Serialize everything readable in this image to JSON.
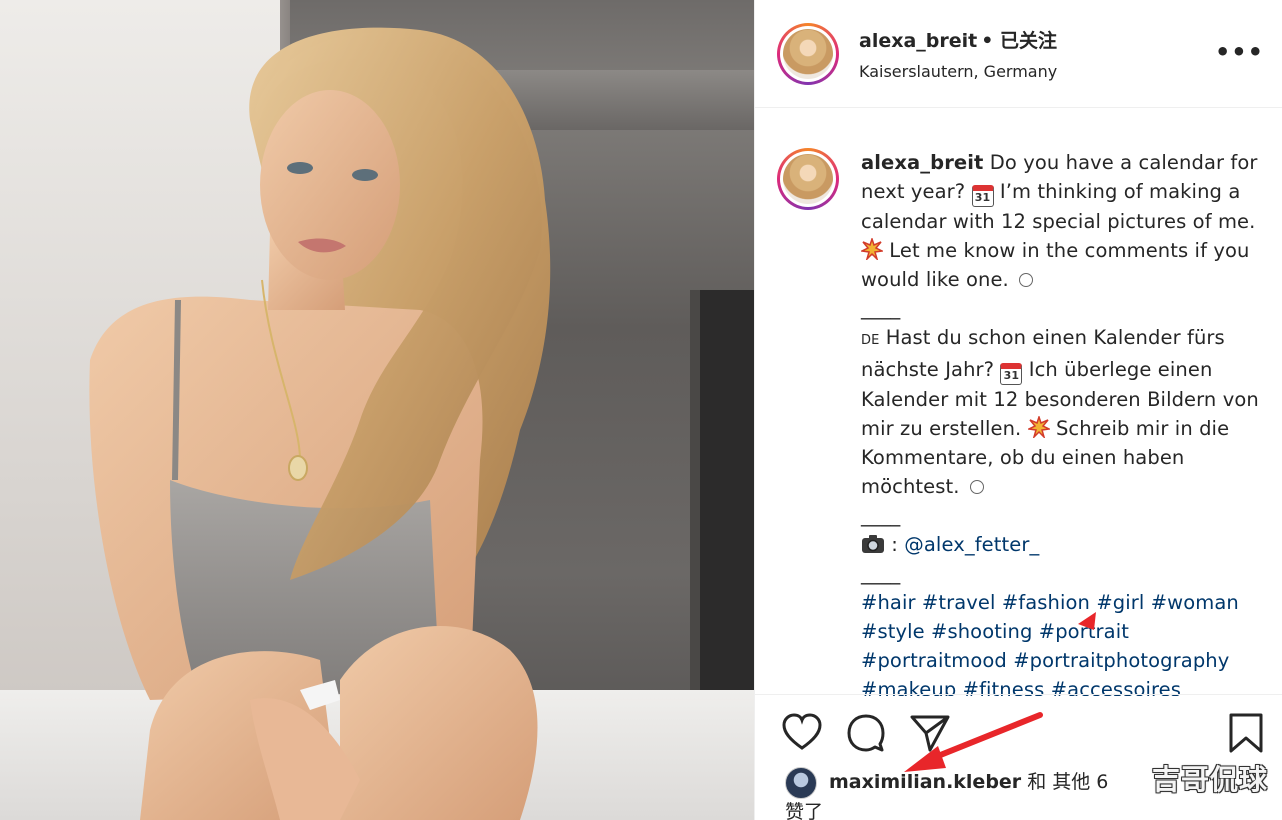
{
  "post": {
    "username": "alexa_breit",
    "follow_status": "• 已关注",
    "location": "Kaiserslautern, Germany",
    "more_label": "•••"
  },
  "caption": {
    "username": "alexa_breit",
    "en_1": " Do you have a calendar for next year? ",
    "calendar_emoji": "31",
    "en_2": " I’m thinking of making a calendar with 12 special pictures of me. ",
    "en_3": " Let me know in the comments if you would like one. ",
    "sep": "____",
    "de_flag": "DE",
    "de_1": " Hast du schon einen Kalender fürs nächste Jahr? ",
    "de_2": " Ich überlege einen Kalender mit 12 besonderen Bildern von mir zu erstellen. ",
    "de_3": " Schreib mir in die Kommentare, ob du einen haben möchtest. ",
    "credit_prefix": " : ",
    "mention": "@alex_fetter_",
    "hashtags": [
      "#hair",
      "#travel",
      "#fashion",
      "#girl",
      "#woman",
      "#style",
      "#shooting",
      "#portrait",
      "#portraitmood",
      "#portraitphotography",
      "#makeup",
      "#fitness",
      "#accessoires"
    ]
  },
  "actions": {
    "like_icon": "heart-icon",
    "comment_icon": "comment-icon",
    "share_icon": "paper-plane-icon",
    "save_icon": "bookmark-icon"
  },
  "likes": {
    "user": "maximilian.kleber",
    "text": " 和 其他 6",
    "line2": "赞了"
  },
  "watermark": "吉哥侃球",
  "colors": {
    "link": "#00376b",
    "text": "#262626",
    "arrow": "#e8262a",
    "ring_start": "#f58529",
    "ring_mid": "#dd2a7b"
  }
}
